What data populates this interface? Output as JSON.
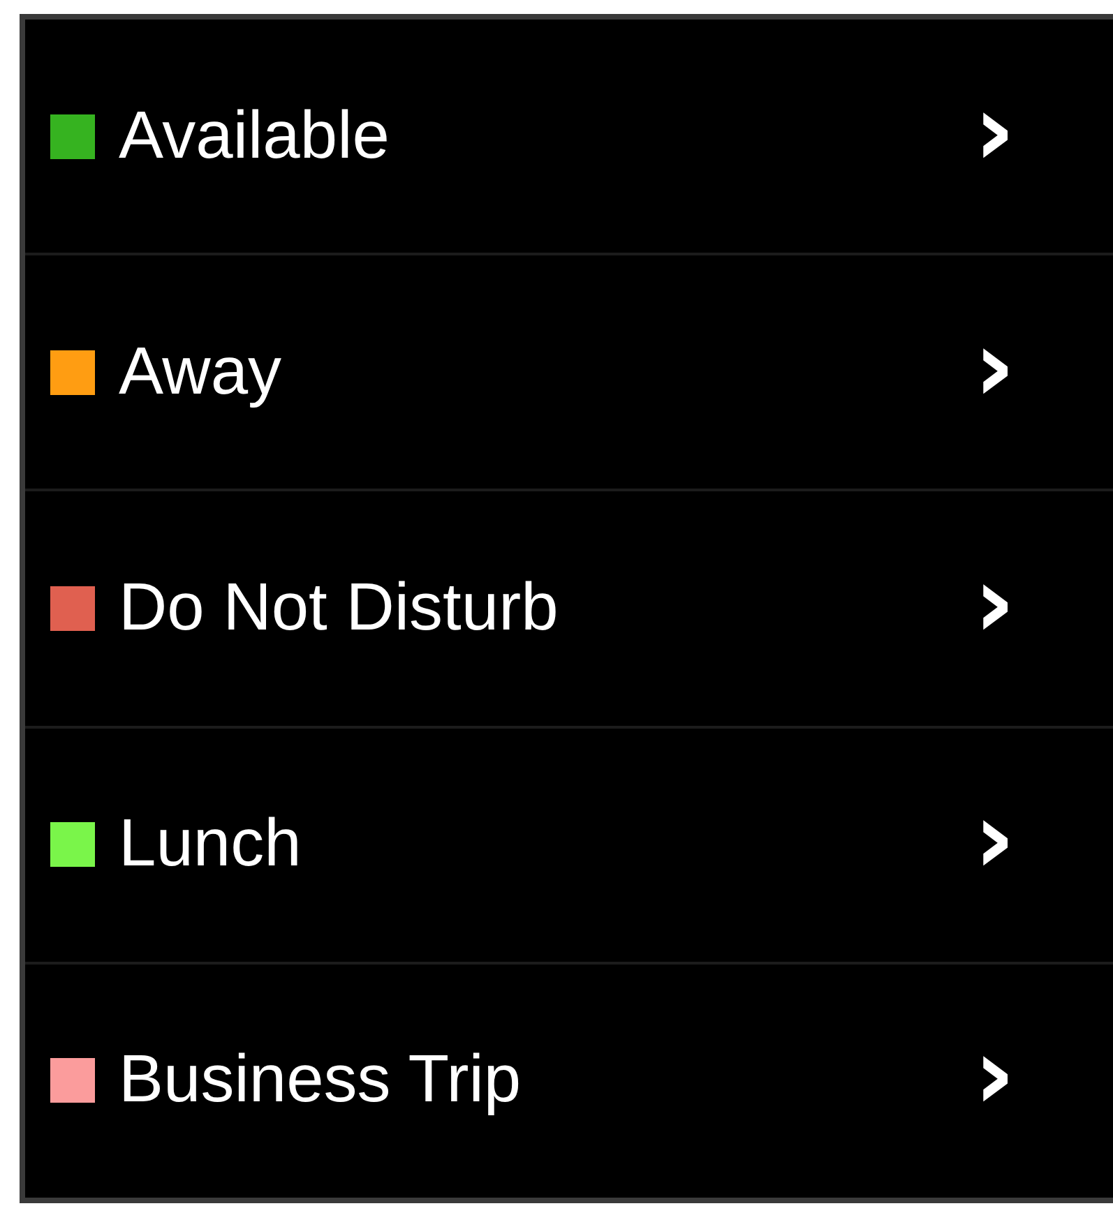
{
  "status_menu": {
    "items": [
      {
        "label": "Available",
        "color": "#36b320",
        "arrow": "›"
      },
      {
        "label": "Away",
        "color": "#ff9d12",
        "arrow": "›"
      },
      {
        "label": "Do Not Disturb",
        "color": "#e06050",
        "arrow": "›"
      },
      {
        "label": "Lunch",
        "color": "#7af54a",
        "arrow": "›"
      },
      {
        "label": "Business Trip",
        "color": "#fb9c9c",
        "arrow": "›"
      }
    ]
  }
}
